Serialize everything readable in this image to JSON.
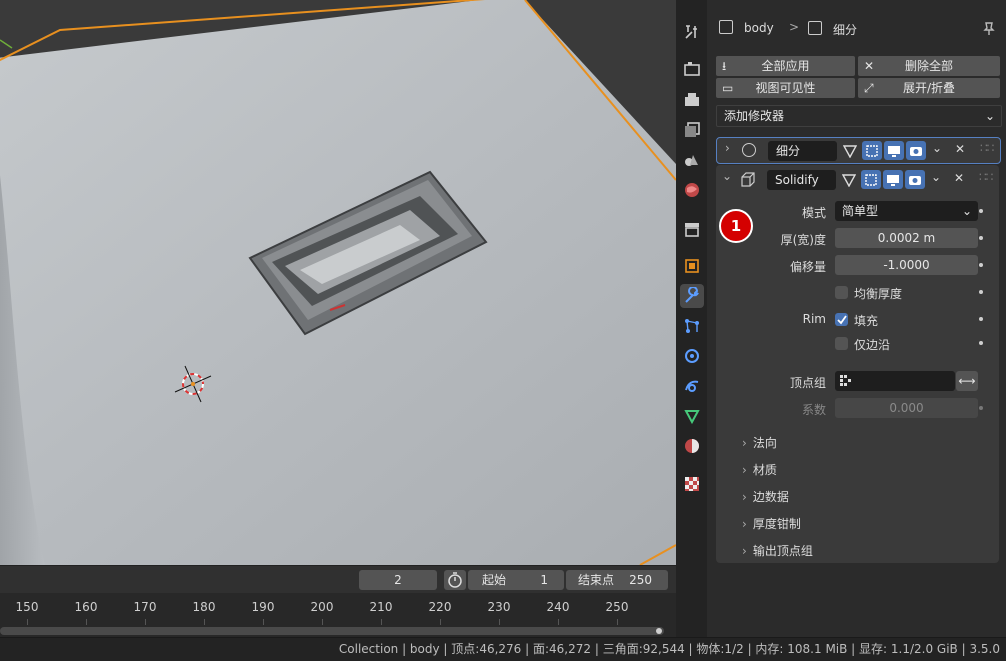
{
  "breadcrumb": {
    "object": "body",
    "modifier": "细分"
  },
  "toolbar": {
    "apply_all": "全部应用",
    "delete_all": "删除全部",
    "viewport_vis": "视图可见性",
    "expand_collapse": "展开/折叠"
  },
  "add_modifier": "添加修改器",
  "modifiers": [
    {
      "name": "细分",
      "expanded": false
    },
    {
      "name": "Solidify",
      "expanded": true
    }
  ],
  "solidify": {
    "badge": "1",
    "mode_label": "模式",
    "mode_value": "简单型",
    "thickness_label": "厚(宽)度",
    "thickness_value": "0.0002 m",
    "offset_label": "偏移量",
    "offset_value": "-1.0000",
    "even_thickness": "均衡厚度",
    "rim_label": "Rim",
    "fill_label": "填充",
    "fill_checked": true,
    "only_rim": "仅边沿",
    "vgroup_label": "顶点组",
    "factor_label": "系数",
    "factor_value": "0.000",
    "subpanels": [
      "法向",
      "材质",
      "边数据",
      "厚度钳制",
      "输出顶点组"
    ]
  },
  "timeline": {
    "current_frame": "2",
    "start_label": "起始",
    "start_value": "1",
    "end_label": "结束点",
    "end_value": "250",
    "ticks": [
      "150",
      "160",
      "170",
      "180",
      "190",
      "200",
      "210",
      "220",
      "230",
      "240",
      "250"
    ]
  },
  "status": "Collection | body | 顶点:46,276 | 面:46,272 | 三角面:92,544 | 物体:1/2 | 内存: 108.1 MiB | 显存: 1.1/2.0 GiB | 3.5.0",
  "colors": {
    "accent": "#4772b3",
    "badge": "#d40000",
    "selection_outline": "#e8901f"
  },
  "icons": [
    "tool-icon",
    "render-icon",
    "output-icon",
    "view-layer-icon",
    "scene-icon",
    "world-icon",
    "collection-icon",
    "object-icon",
    "wrench-icon",
    "particles-icon",
    "physics-icon",
    "constraints-icon",
    "data-icon",
    "material-icon",
    "texture-icon"
  ]
}
